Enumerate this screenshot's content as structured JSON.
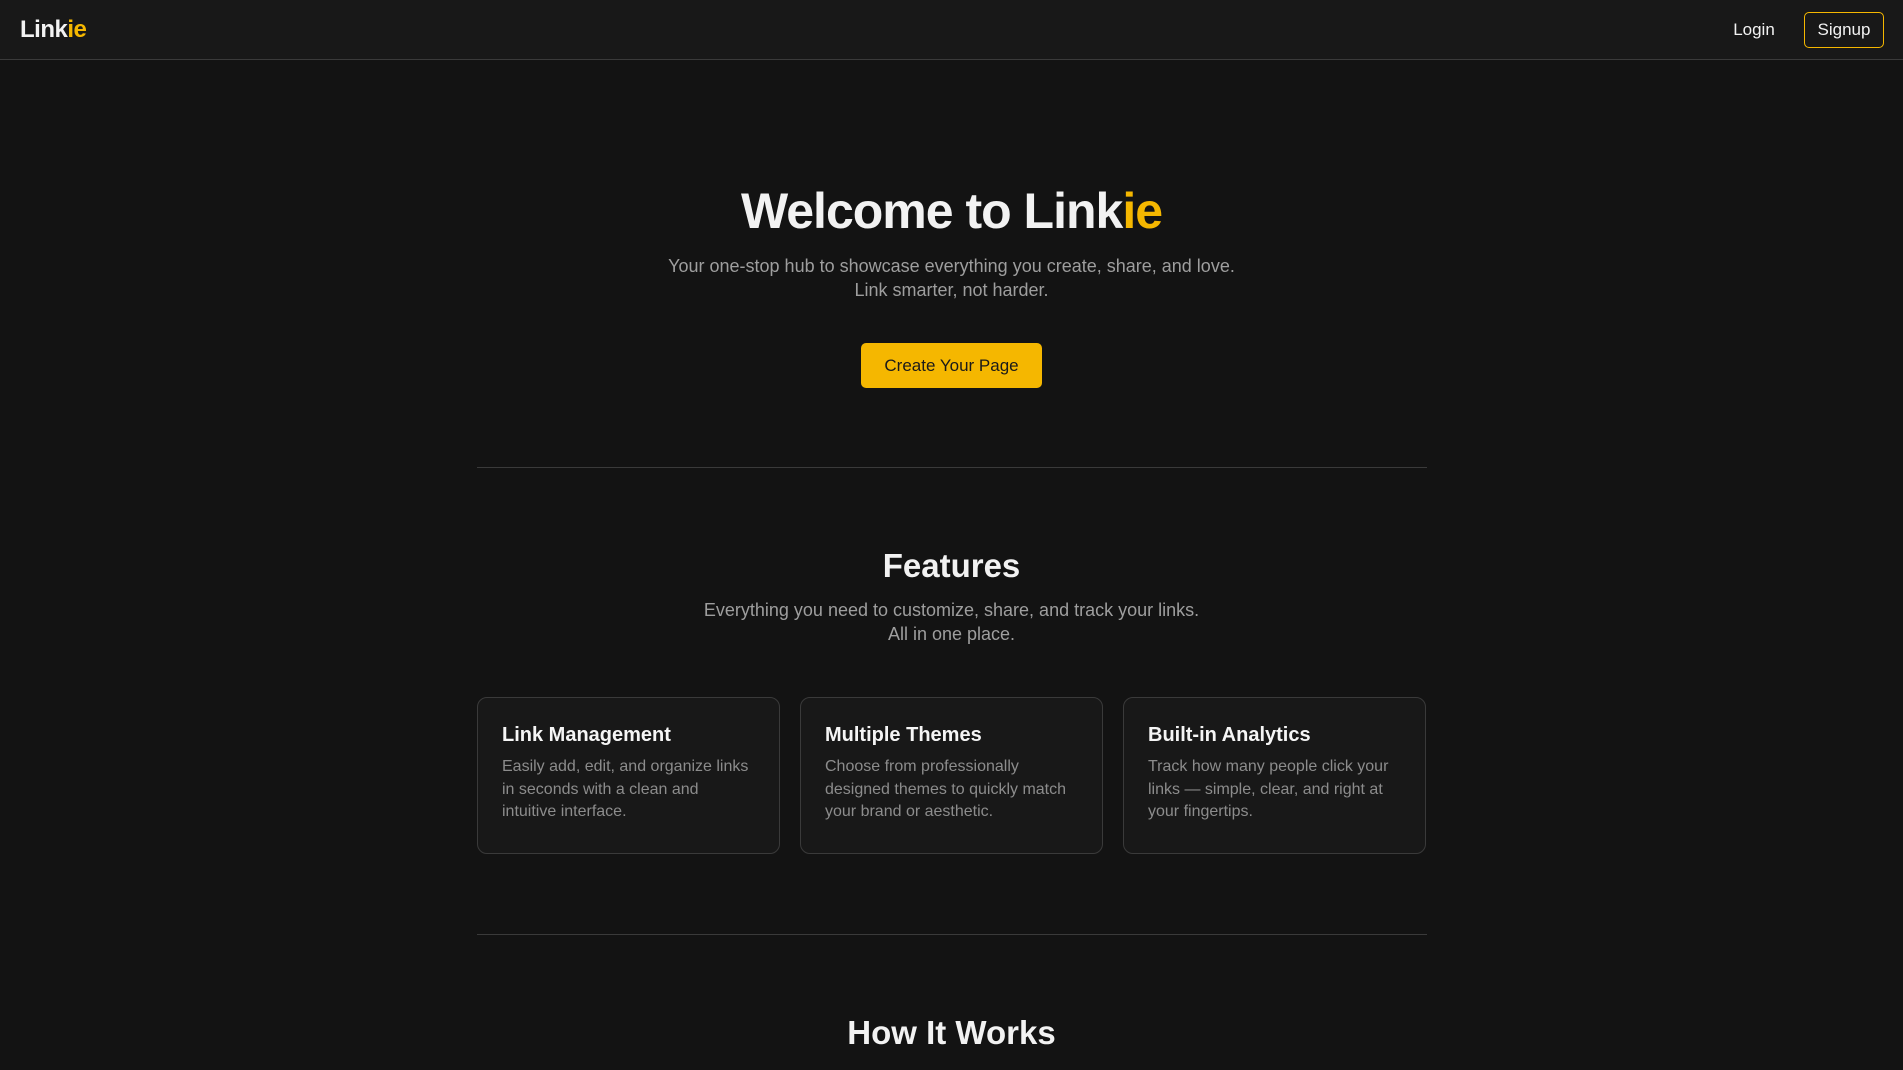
{
  "nav": {
    "logo_main": "Link",
    "logo_accent": "ie",
    "login_label": "Login",
    "signup_label": "Signup"
  },
  "hero": {
    "title_main": "Welcome to Link",
    "title_accent": "ie",
    "subtitle_line1": "Your one-stop hub to showcase everything you create, share, and love.",
    "subtitle_line2": "Link smarter, not harder.",
    "cta_label": "Create Your Page"
  },
  "features": {
    "title": "Features",
    "subtitle_line1": "Everything you need to customize, share, and track your links.",
    "subtitle_line2": "All in one place.",
    "cards": [
      {
        "title": "Link Management",
        "description": "Easily add, edit, and organize links in seconds with a clean and intuitive interface."
      },
      {
        "title": "Multiple Themes",
        "description": "Choose from professionally designed themes to quickly match your brand or aesthetic."
      },
      {
        "title": "Built-in Analytics",
        "description": "Track how many people click your links — simple, clear, and right at your fingertips."
      }
    ]
  },
  "how_it_works": {
    "title": "How It Works"
  },
  "colors": {
    "accent": "#f5b700",
    "background": "#131313",
    "text_primary": "#f2f2f2",
    "text_muted": "#9e9e9e",
    "border": "#3a3a3a"
  }
}
